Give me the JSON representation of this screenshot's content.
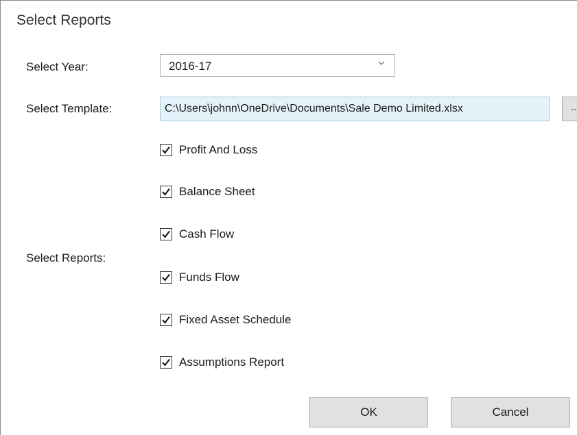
{
  "dialog": {
    "title": "Select Reports"
  },
  "year": {
    "label": "Select Year:",
    "value": "2016-17"
  },
  "template": {
    "label": "Select Template:",
    "path": "C:\\Users\\johnn\\OneDrive\\Documents\\Sale Demo Limited.xlsx",
    "browse_label": "..."
  },
  "reports": {
    "label": "Select Reports:",
    "items": [
      {
        "label": "Profit And Loss",
        "checked": true
      },
      {
        "label": "Balance Sheet",
        "checked": true
      },
      {
        "label": "Cash Flow",
        "checked": true
      },
      {
        "label": "Funds Flow",
        "checked": true
      },
      {
        "label": "Fixed Asset Schedule",
        "checked": true
      },
      {
        "label": "Assumptions Report",
        "checked": true
      }
    ]
  },
  "buttons": {
    "ok": "OK",
    "cancel": "Cancel"
  }
}
